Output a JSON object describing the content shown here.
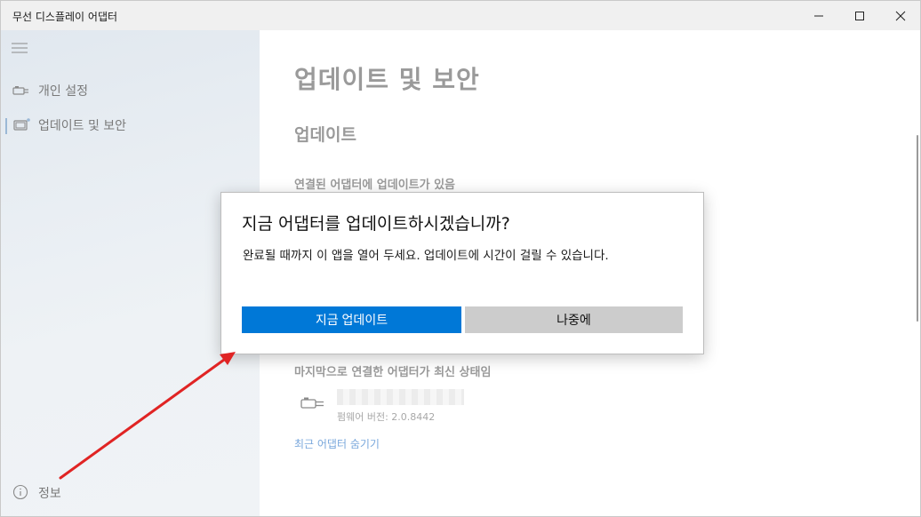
{
  "window": {
    "title": "무선 디스플레이 어댑터",
    "controls": [
      "minimize-icon",
      "maximize-icon",
      "close-icon"
    ]
  },
  "sidebar": {
    "menu_icon": "hamburger-icon",
    "items": [
      {
        "label": "개인 설정",
        "icon": "adapter-icon",
        "active": false
      },
      {
        "label": "업데이트 및 보안",
        "icon": "update-icon",
        "active": true
      }
    ],
    "footer": {
      "label": "정보",
      "icon": "info-icon"
    }
  },
  "main": {
    "page_title": "업데이트 및 보안",
    "section_title": "업데이트",
    "update_status": "연결된 어댑터에 업데이트가 있음",
    "last_status": "마지막으로 연결한 어댑터가 최신 상태임",
    "firmware": "펌웨어 버전: 2.0.8442",
    "hide_link": "최근 어댑터 숨기기"
  },
  "dialog": {
    "title": "지금 어댑터를 업데이트하시겠습니까?",
    "message": "완료될 때까지 이 앱을 열어 두세요. 업데이트에 시간이 걸릴 수 있습니다.",
    "primary_button": "지금 업데이트",
    "secondary_button": "나중에"
  },
  "colors": {
    "accent": "#0078d7",
    "annotation_arrow": "#e02424",
    "link": "#7aa8dc"
  }
}
